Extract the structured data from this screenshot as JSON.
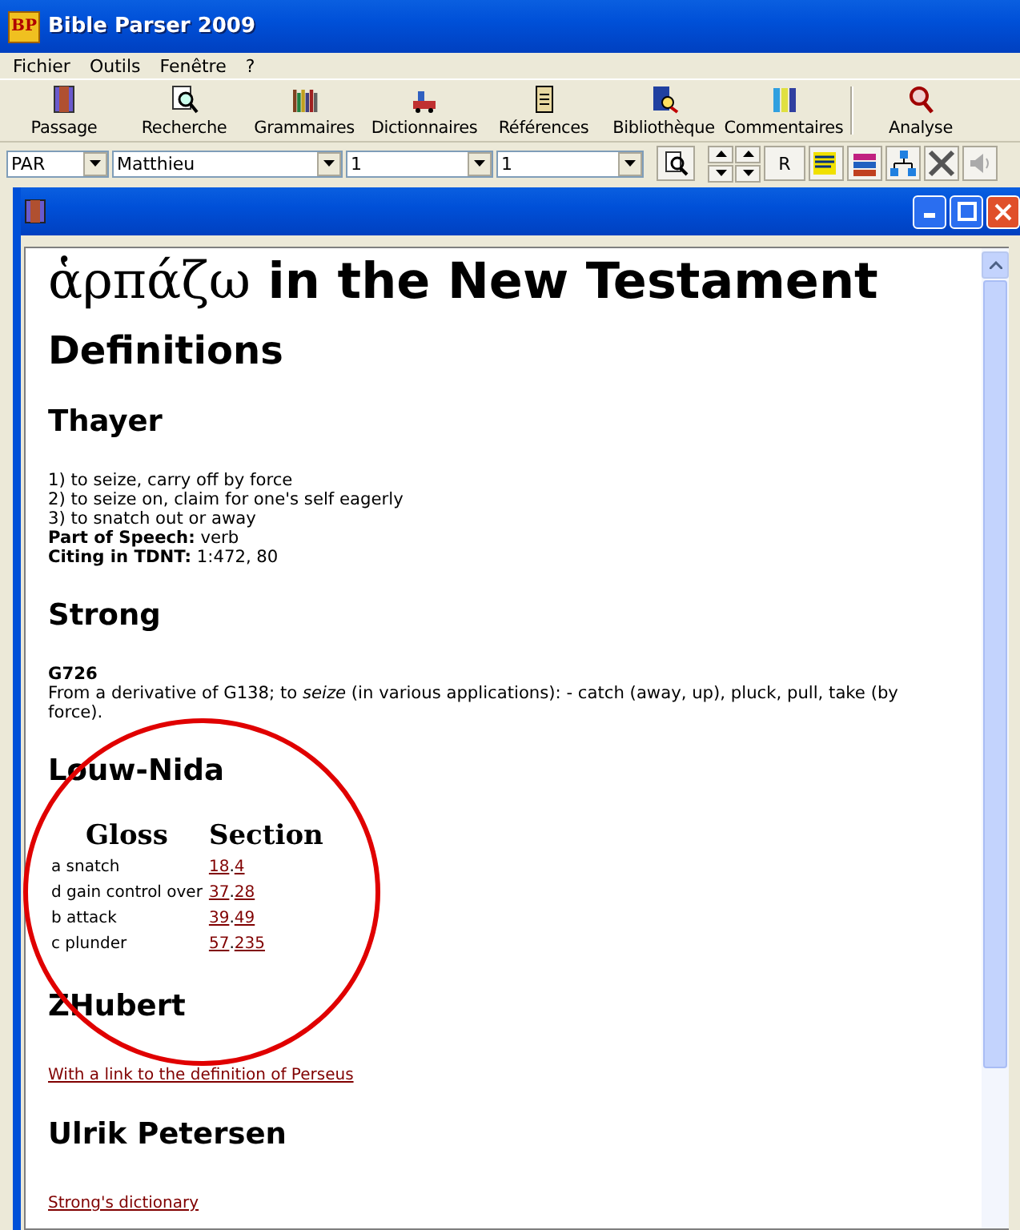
{
  "window": {
    "title": "Bible Parser 2009",
    "logo": "BP"
  },
  "menu": [
    "Fichier",
    "Outils",
    "Fenêtre",
    "?"
  ],
  "toolbar": [
    {
      "label": "Passage",
      "kind": "book"
    },
    {
      "label": "Recherche",
      "kind": "search"
    },
    {
      "label": "Grammaires",
      "kind": "shelf"
    },
    {
      "label": "Dictionnaires",
      "kind": "tray"
    },
    {
      "label": "Références",
      "kind": "scroll"
    },
    {
      "label": "Bibliothèque",
      "kind": "library"
    },
    {
      "label": "Commentaires",
      "kind": "binders"
    },
    {
      "label": "Analyse",
      "kind": "analyse"
    }
  ],
  "selectors": [
    {
      "value": "PAR"
    },
    {
      "value": "Matthieu"
    },
    {
      "value": "1"
    },
    {
      "value": "1"
    }
  ],
  "r_button": "R",
  "document": {
    "title_greek": "ἁρπάζω",
    "title_rest": "in the New Testament",
    "heading": "Definitions",
    "dictionaries": [
      {
        "name": "Thayer",
        "kind": "lines",
        "lines": [
          {
            "text": "1) to seize, carry off by force",
            "bold": false
          },
          {
            "text": "2) to seize on, claim for one's self eagerly",
            "bold": false
          },
          {
            "text": "3) to snatch out or away",
            "bold": false
          },
          {
            "text": "**Part of Speech:** verb",
            "bold": false
          },
          {
            "text": "**Citing in TDNT:** 1:472, 80",
            "bold": false
          }
        ]
      },
      {
        "name": "Strong",
        "kind": "lines",
        "lines": [
          {
            "text": "G726",
            "bold": true
          },
          {
            "text": "From a derivative of G138; to *seize* (in various applications): - catch (away, up), pluck, pull, take (by force).",
            "bold": false
          }
        ]
      },
      {
        "name": "Louw-Nida",
        "kind": "table",
        "columns": [
          "Gloss",
          "Section"
        ],
        "rows": [
          {
            "gloss": "a snatch",
            "section": [
              {
                "text": "18",
                "kind": "link"
              },
              {
                "text": ".",
                "kind": "plain"
              },
              {
                "text": "4",
                "kind": "link"
              }
            ]
          },
          {
            "gloss": "d gain control over",
            "section": [
              {
                "text": "37",
                "kind": "link"
              },
              {
                "text": ".",
                "kind": "plain"
              },
              {
                "text": "28",
                "kind": "link"
              }
            ]
          },
          {
            "gloss": "b attack",
            "section": [
              {
                "text": "39",
                "kind": "link"
              },
              {
                "text": ".",
                "kind": "plain"
              },
              {
                "text": "49",
                "kind": "link"
              }
            ]
          },
          {
            "gloss": "c plunder",
            "section": [
              {
                "text": "57",
                "kind": "link"
              },
              {
                "text": ".",
                "kind": "plain"
              },
              {
                "text": "235",
                "kind": "link"
              }
            ]
          }
        ]
      },
      {
        "name": "ZHubert",
        "kind": "link",
        "link": "With a link to the definition of Perseus"
      },
      {
        "name": "Ulrik Petersen",
        "kind": "link",
        "link": "Strong's dictionary"
      }
    ]
  }
}
